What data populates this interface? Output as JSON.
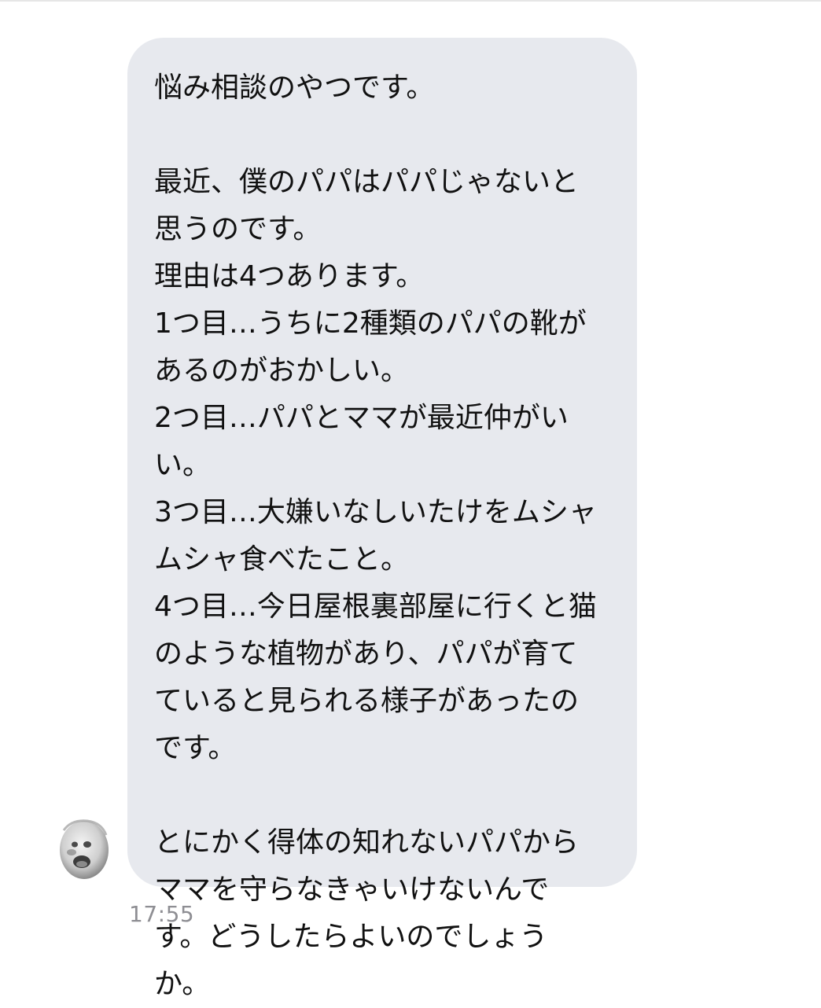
{
  "conversation": {
    "message": {
      "lines": [
        "悩み相談のやつです。",
        "",
        "最近、僕のパパはパパじゃないと",
        "思うのです。",
        "理由は4つあります。",
        "1つ目…うちに2種類のパパの靴が",
        "あるのがおかしい。",
        "2つ目…パパとママが最近仲がい",
        "い。",
        "3つ目…大嫌いなしいたけをムシャ",
        "ムシャ食べたこと。",
        "4つ目…今日屋根裏部屋に行くと猫",
        "のような植物があり、パパが育て",
        "ていると見られる様子があったの",
        "です。",
        "",
        "とにかく得体の知れないパパから",
        "ママを守らなきゃいけないんで",
        "す。どうしたらよいのでしょう",
        "か。"
      ],
      "timestamp": "17:55"
    },
    "sender": {
      "avatar": "baby-face-avatar"
    }
  },
  "colors": {
    "bubble_background": "#e7e9ee",
    "text": "#111111",
    "timestamp": "#8e8e93"
  }
}
